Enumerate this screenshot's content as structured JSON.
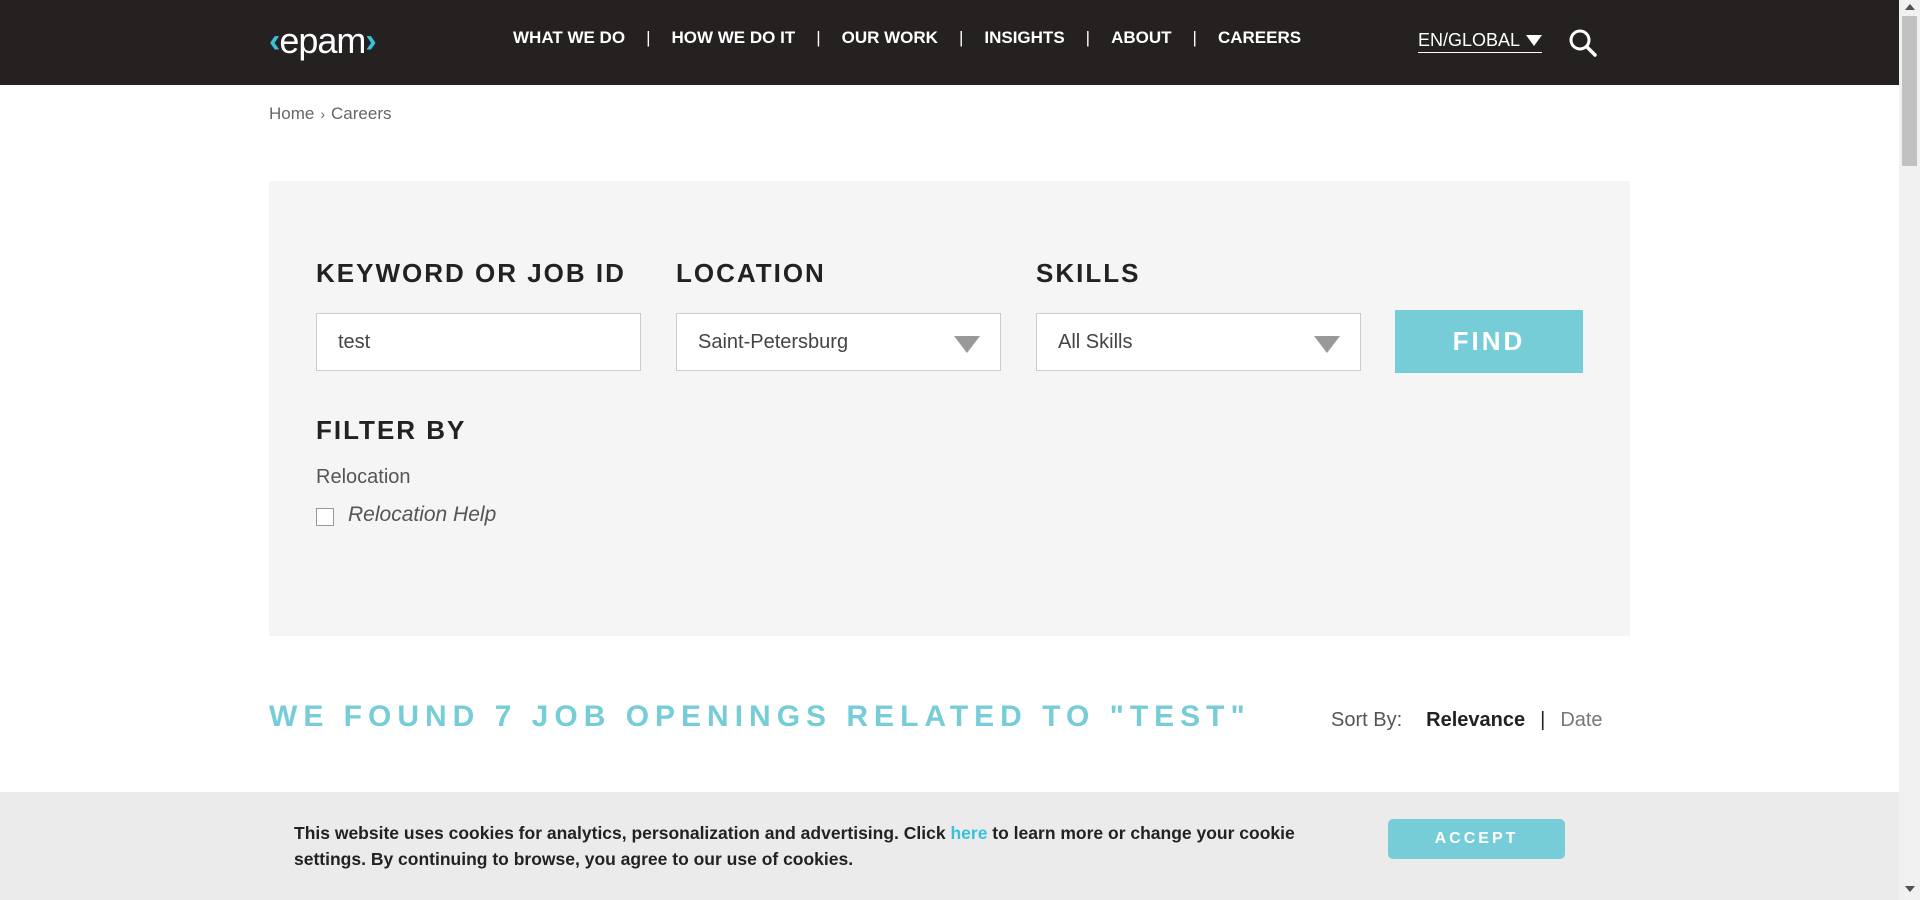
{
  "header": {
    "logo_text": "epam",
    "nav": [
      "WHAT WE DO",
      "HOW WE DO IT",
      "OUR WORK",
      "INSIGHTS",
      "ABOUT",
      "CAREERS"
    ],
    "language": "EN/GLOBAL",
    "search_icon": "search-icon"
  },
  "breadcrumb": {
    "home": "Home",
    "current": "Careers"
  },
  "search_form": {
    "keyword_label": "KEYWORD OR JOB ID",
    "keyword_value": "test",
    "location_label": "LOCATION",
    "location_value": "Saint-Petersburg",
    "skills_label": "SKILLS",
    "skills_value": "All Skills",
    "find_label": "FIND"
  },
  "filters": {
    "title": "FILTER BY",
    "group_label": "Relocation",
    "option_label": "Relocation Help",
    "option_checked": false
  },
  "results": {
    "heading": "WE FOUND 7 JOB OPENINGS RELATED TO \"TEST\"",
    "sort_label": "Sort By:",
    "sort_relevance": "Relevance",
    "sort_separator": "|",
    "sort_date": "Date"
  },
  "cookie_banner": {
    "text_before": "This website uses cookies for analytics, personalization and advertising. Click ",
    "link_text": "here",
    "text_after": " to learn more or change your cookie settings. By continuing to browse, you agree to our use of cookies.",
    "accept_label": "ACCEPT"
  },
  "colors": {
    "header_bg": "#262121",
    "accent": "#76cdd8",
    "logo_accent": "#39c2d7",
    "panel_bg": "#f5f5f5",
    "cookie_bg": "#ebebeb"
  }
}
